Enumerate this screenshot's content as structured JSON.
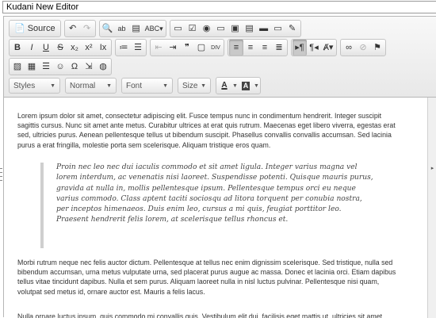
{
  "window": {
    "title": "Kudani New Editor"
  },
  "toolbar": {
    "row1": [
      {
        "name": "source-button",
        "glyph": "📄",
        "label": "Source",
        "on": false,
        "dis": false
      },
      {
        "name": "undo-button",
        "glyph": "↶",
        "label": "",
        "on": false,
        "dis": false
      },
      {
        "name": "redo-button",
        "glyph": "↷",
        "label": "",
        "on": false,
        "dis": true
      },
      {
        "name": "find-button",
        "glyph": "🔍",
        "label": "",
        "on": false,
        "dis": false
      },
      {
        "name": "replace-button",
        "glyph": "ab",
        "label": "",
        "on": false,
        "dis": false
      },
      {
        "name": "select-all-button",
        "glyph": "▤",
        "label": "",
        "on": false,
        "dis": false
      },
      {
        "name": "spellcheck-button",
        "glyph": "ABC▾",
        "label": "",
        "on": false,
        "dis": false
      },
      {
        "name": "form-button",
        "glyph": "▭",
        "label": "",
        "on": false,
        "dis": false
      },
      {
        "name": "checkbox-button",
        "glyph": "☑",
        "label": "",
        "on": false,
        "dis": false
      },
      {
        "name": "radio-button",
        "glyph": "◉",
        "label": "",
        "on": false,
        "dis": false
      },
      {
        "name": "textfield-button",
        "glyph": "▭",
        "label": "",
        "on": false,
        "dis": false
      },
      {
        "name": "textarea-button",
        "glyph": "▣",
        "label": "",
        "on": false,
        "dis": false
      },
      {
        "name": "select-button",
        "glyph": "▤",
        "label": "",
        "on": false,
        "dis": false
      },
      {
        "name": "image-button-button",
        "glyph": "▬",
        "label": "",
        "on": false,
        "dis": false
      },
      {
        "name": "hidden-field-button",
        "glyph": "▭",
        "label": "",
        "on": false,
        "dis": false
      },
      {
        "name": "imagebutton-field-button",
        "glyph": "✎",
        "label": "",
        "on": false,
        "dis": false
      }
    ],
    "row2": [
      {
        "name": "bold-button",
        "glyph": "B",
        "label": "",
        "on": false,
        "dis": false
      },
      {
        "name": "italic-button",
        "glyph": "I",
        "label": "",
        "on": false,
        "dis": false
      },
      {
        "name": "underline-button",
        "glyph": "U",
        "label": "",
        "on": false,
        "dis": false
      },
      {
        "name": "strike-button",
        "glyph": "S",
        "label": "",
        "on": false,
        "dis": false
      },
      {
        "name": "subscript-button",
        "glyph": "x₂",
        "label": "",
        "on": false,
        "dis": false
      },
      {
        "name": "superscript-button",
        "glyph": "x²",
        "label": "",
        "on": false,
        "dis": false
      },
      {
        "name": "remove-format-button",
        "glyph": "Ix",
        "label": "",
        "on": false,
        "dis": false
      },
      {
        "name": "numbered-list-button",
        "glyph": "≔",
        "label": "",
        "on": false,
        "dis": false
      },
      {
        "name": "bulleted-list-button",
        "glyph": "☰",
        "label": "",
        "on": false,
        "dis": false
      },
      {
        "name": "outdent-button",
        "glyph": "⇤",
        "label": "",
        "on": false,
        "dis": true
      },
      {
        "name": "indent-button",
        "glyph": "⇥",
        "label": "",
        "on": false,
        "dis": false
      },
      {
        "name": "blockquote-button",
        "glyph": "❞",
        "label": "",
        "on": false,
        "dis": false
      },
      {
        "name": "div-button",
        "glyph": "▢",
        "label": "",
        "on": false,
        "dis": false
      },
      {
        "name": "div-container-button",
        "glyph": "DIV",
        "label": "",
        "on": false,
        "dis": false
      },
      {
        "name": "align-left-button",
        "glyph": "≡",
        "label": "",
        "on": true,
        "dis": false
      },
      {
        "name": "align-center-button",
        "glyph": "≡",
        "label": "",
        "on": false,
        "dis": false
      },
      {
        "name": "align-right-button",
        "glyph": "≡",
        "label": "",
        "on": false,
        "dis": false
      },
      {
        "name": "justify-button",
        "glyph": "≣",
        "label": "",
        "on": false,
        "dis": false
      },
      {
        "name": "ltr-button",
        "glyph": "▸¶",
        "label": "",
        "on": true,
        "dis": false
      },
      {
        "name": "rtl-button",
        "glyph": "¶◂",
        "label": "",
        "on": false,
        "dis": false
      },
      {
        "name": "language-button",
        "glyph": "Ⱥ▾",
        "label": "",
        "on": false,
        "dis": false
      },
      {
        "name": "link-button",
        "glyph": "∞",
        "label": "",
        "on": false,
        "dis": false
      },
      {
        "name": "unlink-button",
        "glyph": "⊘",
        "label": "",
        "on": false,
        "dis": true
      },
      {
        "name": "anchor-button",
        "glyph": "⚑",
        "label": "",
        "on": false,
        "dis": false
      }
    ],
    "row3": [
      {
        "name": "image-button",
        "glyph": "▨",
        "label": "",
        "on": false,
        "dis": false
      },
      {
        "name": "table-button",
        "glyph": "▦",
        "label": "",
        "on": false,
        "dis": false
      },
      {
        "name": "horizontal-line-button",
        "glyph": "☰",
        "label": "",
        "on": false,
        "dis": false
      },
      {
        "name": "smiley-button",
        "glyph": "☺",
        "label": "",
        "on": false,
        "dis": false
      },
      {
        "name": "special-char-button",
        "glyph": "Ω",
        "label": "",
        "on": false,
        "dis": false
      },
      {
        "name": "page-break-button",
        "glyph": "⇲",
        "label": "",
        "on": false,
        "dis": false
      },
      {
        "name": "iframe-button",
        "glyph": "◍",
        "label": "",
        "on": false,
        "dis": false
      }
    ],
    "row4": {
      "styles": "Styles",
      "format": "Normal",
      "font": "Font",
      "size": "Size",
      "text_color_glyph": "A",
      "bg_color_glyph": "A"
    }
  },
  "content": {
    "paragraph1": "Lorem ipsum dolor sit amet, consectetur adipiscing elit. Fusce tempus nunc in condimentum hendrerit. Integer suscipit sagittis cursus. Nunc sit amet ante metus. Curabitur ultrices at erat quis rutrum. Maecenas eget libero viverra, egestas erat sed, ultricies purus. Aenean pellentesque tellus ut bibendum suscipit. Phasellus convallis convallis accumsan. Sed lacinia purus a erat fringilla, molestie porta sem scelerisque. Aliquam tristique eros quam.",
    "quote": "Proin nec leo nec dui iaculis commodo et sit amet ligula. Integer varius magna vel lorem interdum, ac venenatis nisi laoreet. Suspendisse potenti. Quisque mauris purus, gravida at nulla in, mollis pellentesque ipsum. Pellentesque tempus orci eu neque varius commodo. Class aptent taciti sociosqu ad litora torquent per conubia nostra, per inceptos himenaeos. Duis enim leo, cursus a mi quis, feugiat porttitor leo. Praesent hendrerit felis lorem, at scelerisque tellus rhoncus et.",
    "paragraph2": "Morbi rutrum neque nec felis auctor dictum. Pellentesque at tellus nec enim dignissim scelerisque. Sed tristique, nulla sed bibendum accumsan, urna metus vulputate urna, sed placerat purus augue ac massa. Donec et lacinia orci. Etiam dapibus tellus vitae tincidunt dapibus. Nulla et sem purus. Aliquam laoreet nulla in nisl luctus pulvinar. Pellentesque nisi quam, volutpat sed metus id, ornare auctor est. Mauris a felis lacus.",
    "paragraph3": "Nulla ornare luctus ipsum, quis commodo mi convallis quis. Vestibulum elit dui, facilisis eget mattis ut, ultricies sit amet."
  },
  "colors": {
    "text_color_bar": "#000000",
    "bg_color_box": "#444444"
  }
}
